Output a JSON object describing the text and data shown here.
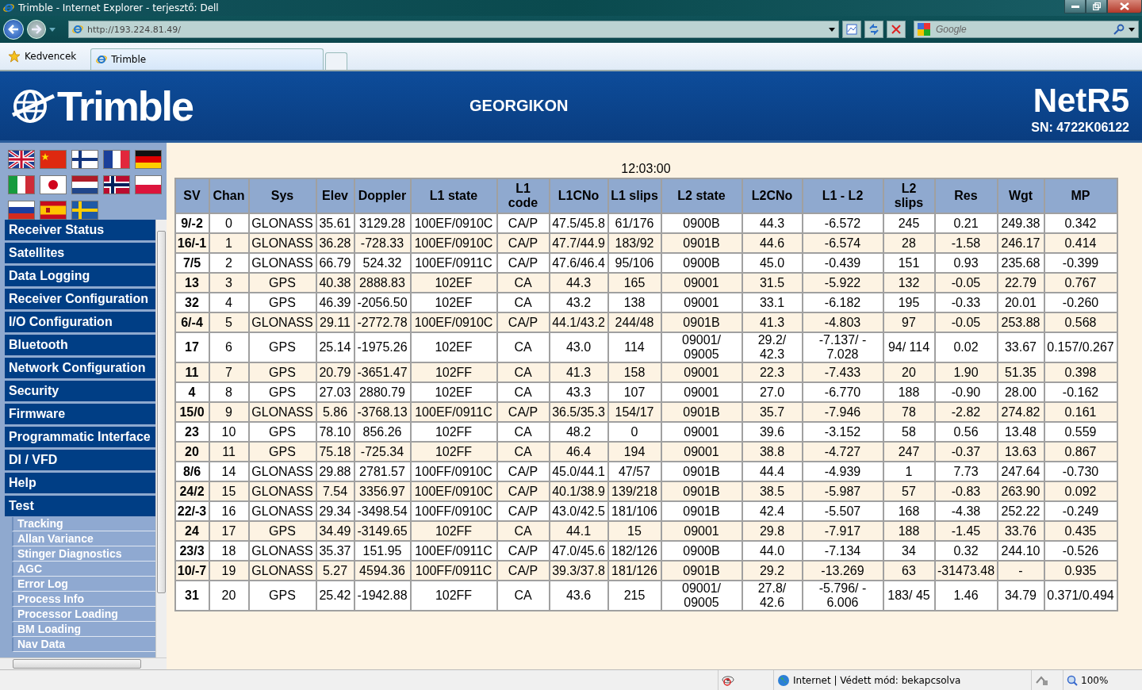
{
  "browser": {
    "title": "Trimble - Internet Explorer - terjesztő: Dell",
    "address": "http://193.224.81.49/",
    "search_placeholder": "Google",
    "favorites": "Kedvencek",
    "tabs": [
      {
        "label": "Trimble",
        "selected": true
      }
    ]
  },
  "header": {
    "brand": "Trimble",
    "site": "GEORGIKON",
    "model": "NetR5",
    "serial": "SN: 4722K06122"
  },
  "nav": [
    {
      "label": "Receiver Status"
    },
    {
      "label": "Satellites"
    },
    {
      "label": "Data Logging"
    },
    {
      "label": "Receiver Configuration"
    },
    {
      "label": "I/O Configuration"
    },
    {
      "label": "Bluetooth"
    },
    {
      "label": "Network Configuration"
    },
    {
      "label": "Security"
    },
    {
      "label": "Firmware"
    },
    {
      "label": "Programmatic Interface"
    },
    {
      "label": "DI / VFD"
    },
    {
      "label": "Help"
    },
    {
      "label": "Test",
      "children": [
        {
          "label": "Tracking"
        },
        {
          "label": "Allan Variance"
        },
        {
          "label": "Stinger Diagnostics"
        },
        {
          "label": "AGC"
        },
        {
          "label": "Error Log"
        },
        {
          "label": "Process Info"
        },
        {
          "label": "Processor Loading"
        },
        {
          "label": "BM Loading"
        },
        {
          "label": "Nav Data"
        }
      ]
    }
  ],
  "time": "12:03:00",
  "table": {
    "columns": [
      "SV",
      "Chan",
      "Sys",
      "Elev",
      "Doppler",
      "L1 state",
      "L1\ncode",
      "L1CNo",
      "L1 slips",
      "L2 state",
      "L2CNo",
      "L1 - L2",
      "L2\nslips",
      "Res",
      "Wgt",
      "MP"
    ],
    "rows": [
      [
        "9/-2",
        "0",
        "GLONASS",
        "35.61",
        "3129.28",
        "100EF/0910C",
        "CA/P",
        "47.5/45.8",
        "61/176",
        "0900B",
        "44.3",
        "-6.572",
        "245",
        "0.21",
        "249.38",
        "0.342"
      ],
      [
        "16/-1",
        "1",
        "GLONASS",
        "36.28",
        "-728.33",
        "100EF/0910C",
        "CA/P",
        "47.7/44.9",
        "183/92",
        "0901B",
        "44.6",
        "-6.574",
        "28",
        "-1.58",
        "246.17",
        "0.414"
      ],
      [
        "7/5",
        "2",
        "GLONASS",
        "66.79",
        "524.32",
        "100EF/0911C",
        "CA/P",
        "47.6/46.4",
        "95/106",
        "0900B",
        "45.0",
        "-0.439",
        "151",
        "0.93",
        "235.68",
        "-0.399"
      ],
      [
        "13",
        "3",
        "GPS",
        "40.38",
        "2888.83",
        "102EF",
        "CA",
        "44.3",
        "165",
        "09001",
        "31.5",
        "-5.922",
        "132",
        "-0.05",
        "22.79",
        "0.767"
      ],
      [
        "32",
        "4",
        "GPS",
        "46.39",
        "-2056.50",
        "102EF",
        "CA",
        "43.2",
        "138",
        "09001",
        "33.1",
        "-6.182",
        "195",
        "-0.33",
        "20.01",
        "-0.260"
      ],
      [
        "6/-4",
        "5",
        "GLONASS",
        "29.11",
        "-2772.78",
        "100EF/0910C",
        "CA/P",
        "44.1/43.2",
        "244/48",
        "0901B",
        "41.3",
        "-4.803",
        "97",
        "-0.05",
        "253.88",
        "0.568"
      ],
      [
        "17",
        "6",
        "GPS",
        "25.14",
        "-1975.26",
        "102EF",
        "CA",
        "43.0",
        "114",
        "09001/\n09005",
        "29.2/\n42.3",
        "-7.137/ -\n7.028",
        "94/ 114",
        "0.02",
        "33.67",
        "0.157/0.267"
      ],
      [
        "11",
        "7",
        "GPS",
        "20.79",
        "-3651.47",
        "102FF",
        "CA",
        "41.3",
        "158",
        "09001",
        "22.3",
        "-7.433",
        "20",
        "1.90",
        "51.35",
        "0.398"
      ],
      [
        "4",
        "8",
        "GPS",
        "27.03",
        "2880.79",
        "102EF",
        "CA",
        "43.3",
        "107",
        "09001",
        "27.0",
        "-6.770",
        "188",
        "-0.90",
        "28.00",
        "-0.162"
      ],
      [
        "15/0",
        "9",
        "GLONASS",
        "5.86",
        "-3768.13",
        "100EF/0911C",
        "CA/P",
        "36.5/35.3",
        "154/17",
        "0901B",
        "35.7",
        "-7.946",
        "78",
        "-2.82",
        "274.82",
        "0.161"
      ],
      [
        "23",
        "10",
        "GPS",
        "78.10",
        "856.26",
        "102FF",
        "CA",
        "48.2",
        "0",
        "09001",
        "39.6",
        "-3.152",
        "58",
        "0.56",
        "13.48",
        "0.559"
      ],
      [
        "20",
        "11",
        "GPS",
        "75.18",
        "-725.34",
        "102FF",
        "CA",
        "46.4",
        "194",
        "09001",
        "38.8",
        "-4.727",
        "247",
        "-0.37",
        "13.63",
        "0.867"
      ],
      [
        "8/6",
        "14",
        "GLONASS",
        "29.88",
        "2781.57",
        "100FF/0910C",
        "CA/P",
        "45.0/44.1",
        "47/57",
        "0901B",
        "44.4",
        "-4.939",
        "1",
        "7.73",
        "247.64",
        "-0.730"
      ],
      [
        "24/2",
        "15",
        "GLONASS",
        "7.54",
        "3356.97",
        "100EF/0910C",
        "CA/P",
        "40.1/38.9",
        "139/218",
        "0901B",
        "38.5",
        "-5.987",
        "57",
        "-0.83",
        "263.90",
        "0.092"
      ],
      [
        "22/-3",
        "16",
        "GLONASS",
        "29.34",
        "-3498.54",
        "100FF/0910C",
        "CA/P",
        "43.0/42.5",
        "181/106",
        "0901B",
        "42.4",
        "-5.507",
        "168",
        "-4.38",
        "252.22",
        "-0.249"
      ],
      [
        "24",
        "17",
        "GPS",
        "34.49",
        "-3149.65",
        "102FF",
        "CA",
        "44.1",
        "15",
        "09001",
        "29.8",
        "-7.917",
        "188",
        "-1.45",
        "33.76",
        "0.435"
      ],
      [
        "23/3",
        "18",
        "GLONASS",
        "35.37",
        "151.95",
        "100EF/0911C",
        "CA/P",
        "47.0/45.6",
        "182/126",
        "0900B",
        "44.0",
        "-7.134",
        "34",
        "0.32",
        "244.10",
        "-0.526"
      ],
      [
        "10/-7",
        "19",
        "GLONASS",
        "5.27",
        "4594.36",
        "100FF/0911C",
        "CA/P",
        "39.3/37.8",
        "181/126",
        "0901B",
        "29.2",
        "-13.269",
        "63",
        "-31473.48",
        "-",
        "0.935"
      ],
      [
        "31",
        "20",
        "GPS",
        "25.42",
        "-1942.88",
        "102FF",
        "CA",
        "43.6",
        "215",
        "09001/\n09005",
        "27.8/\n42.6",
        "-5.796/ -\n6.006",
        "183/ 45",
        "1.46",
        "34.79",
        "0.371/0.494"
      ]
    ]
  },
  "status_bar": {
    "zone": "Internet | Védett mód: bekapcsolva",
    "zoom": "100%"
  }
}
